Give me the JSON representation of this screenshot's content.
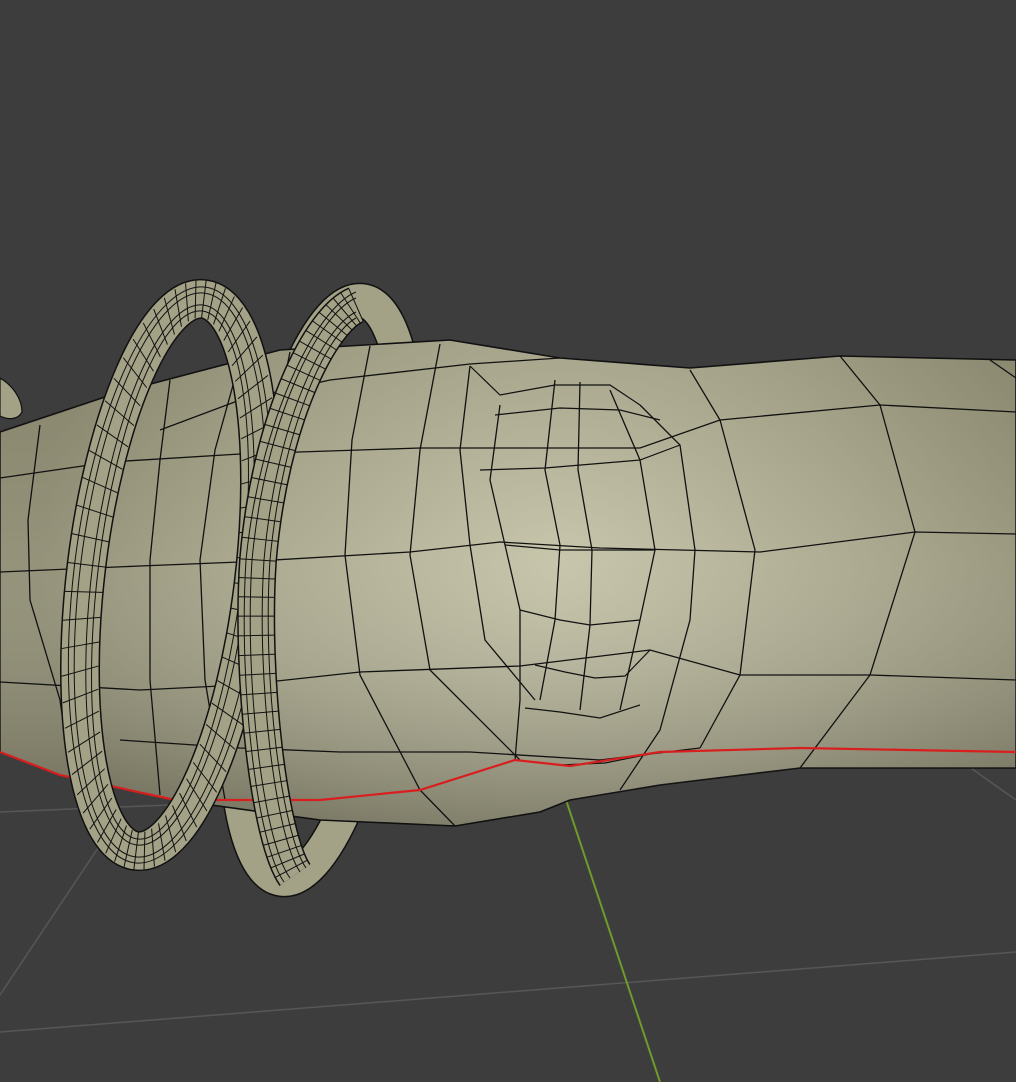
{
  "viewport": {
    "mode": "edit-mode-wireframe",
    "background_color": "#3d3d3d",
    "grid_color": "#575757",
    "y_axis_color": "#6f9a2c",
    "seam_color": "#d81e1e",
    "mesh_color": "#a8a68a",
    "wire_color": "#111111"
  },
  "objects": [
    {
      "name": "tube-body"
    },
    {
      "name": "torus-ring-front"
    },
    {
      "name": "torus-ring-back"
    }
  ]
}
